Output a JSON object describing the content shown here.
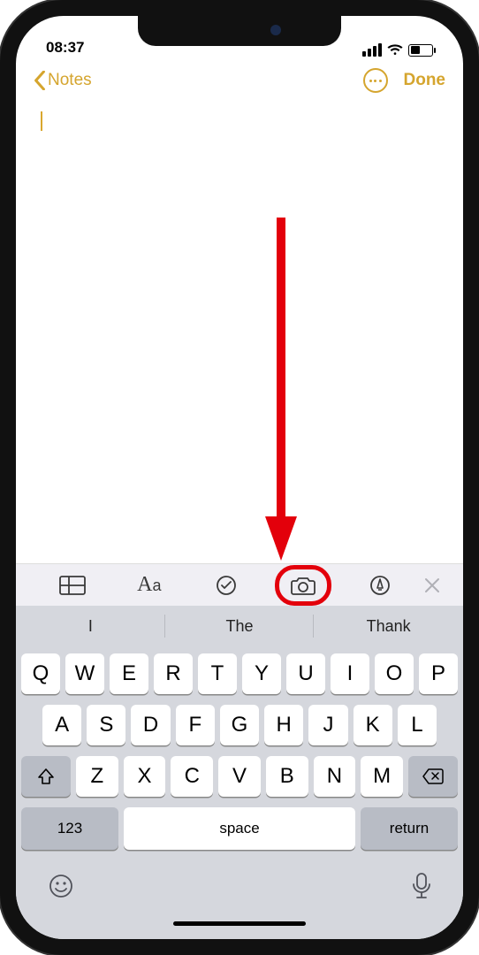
{
  "status": {
    "time": "08:37"
  },
  "nav": {
    "back_label": "Notes",
    "done_label": "Done"
  },
  "note": {
    "content": ""
  },
  "toolbar": {
    "icons": [
      "table-icon",
      "textformat-icon",
      "checklist-icon",
      "camera-icon",
      "markup-icon"
    ],
    "highlighted_icon": "camera-icon"
  },
  "predictive": {
    "s1": "I",
    "s2": "The",
    "s3": "Thank"
  },
  "keyboard": {
    "row1": [
      "Q",
      "W",
      "E",
      "R",
      "T",
      "Y",
      "U",
      "I",
      "O",
      "P"
    ],
    "row2": [
      "A",
      "S",
      "D",
      "F",
      "G",
      "H",
      "J",
      "K",
      "L"
    ],
    "row3": [
      "Z",
      "X",
      "C",
      "V",
      "B",
      "N",
      "M"
    ],
    "num_label": "123",
    "space_label": "space",
    "return_label": "return"
  },
  "annotation": {
    "type": "arrow-circle",
    "target": "camera-icon",
    "color": "#e3000b"
  }
}
